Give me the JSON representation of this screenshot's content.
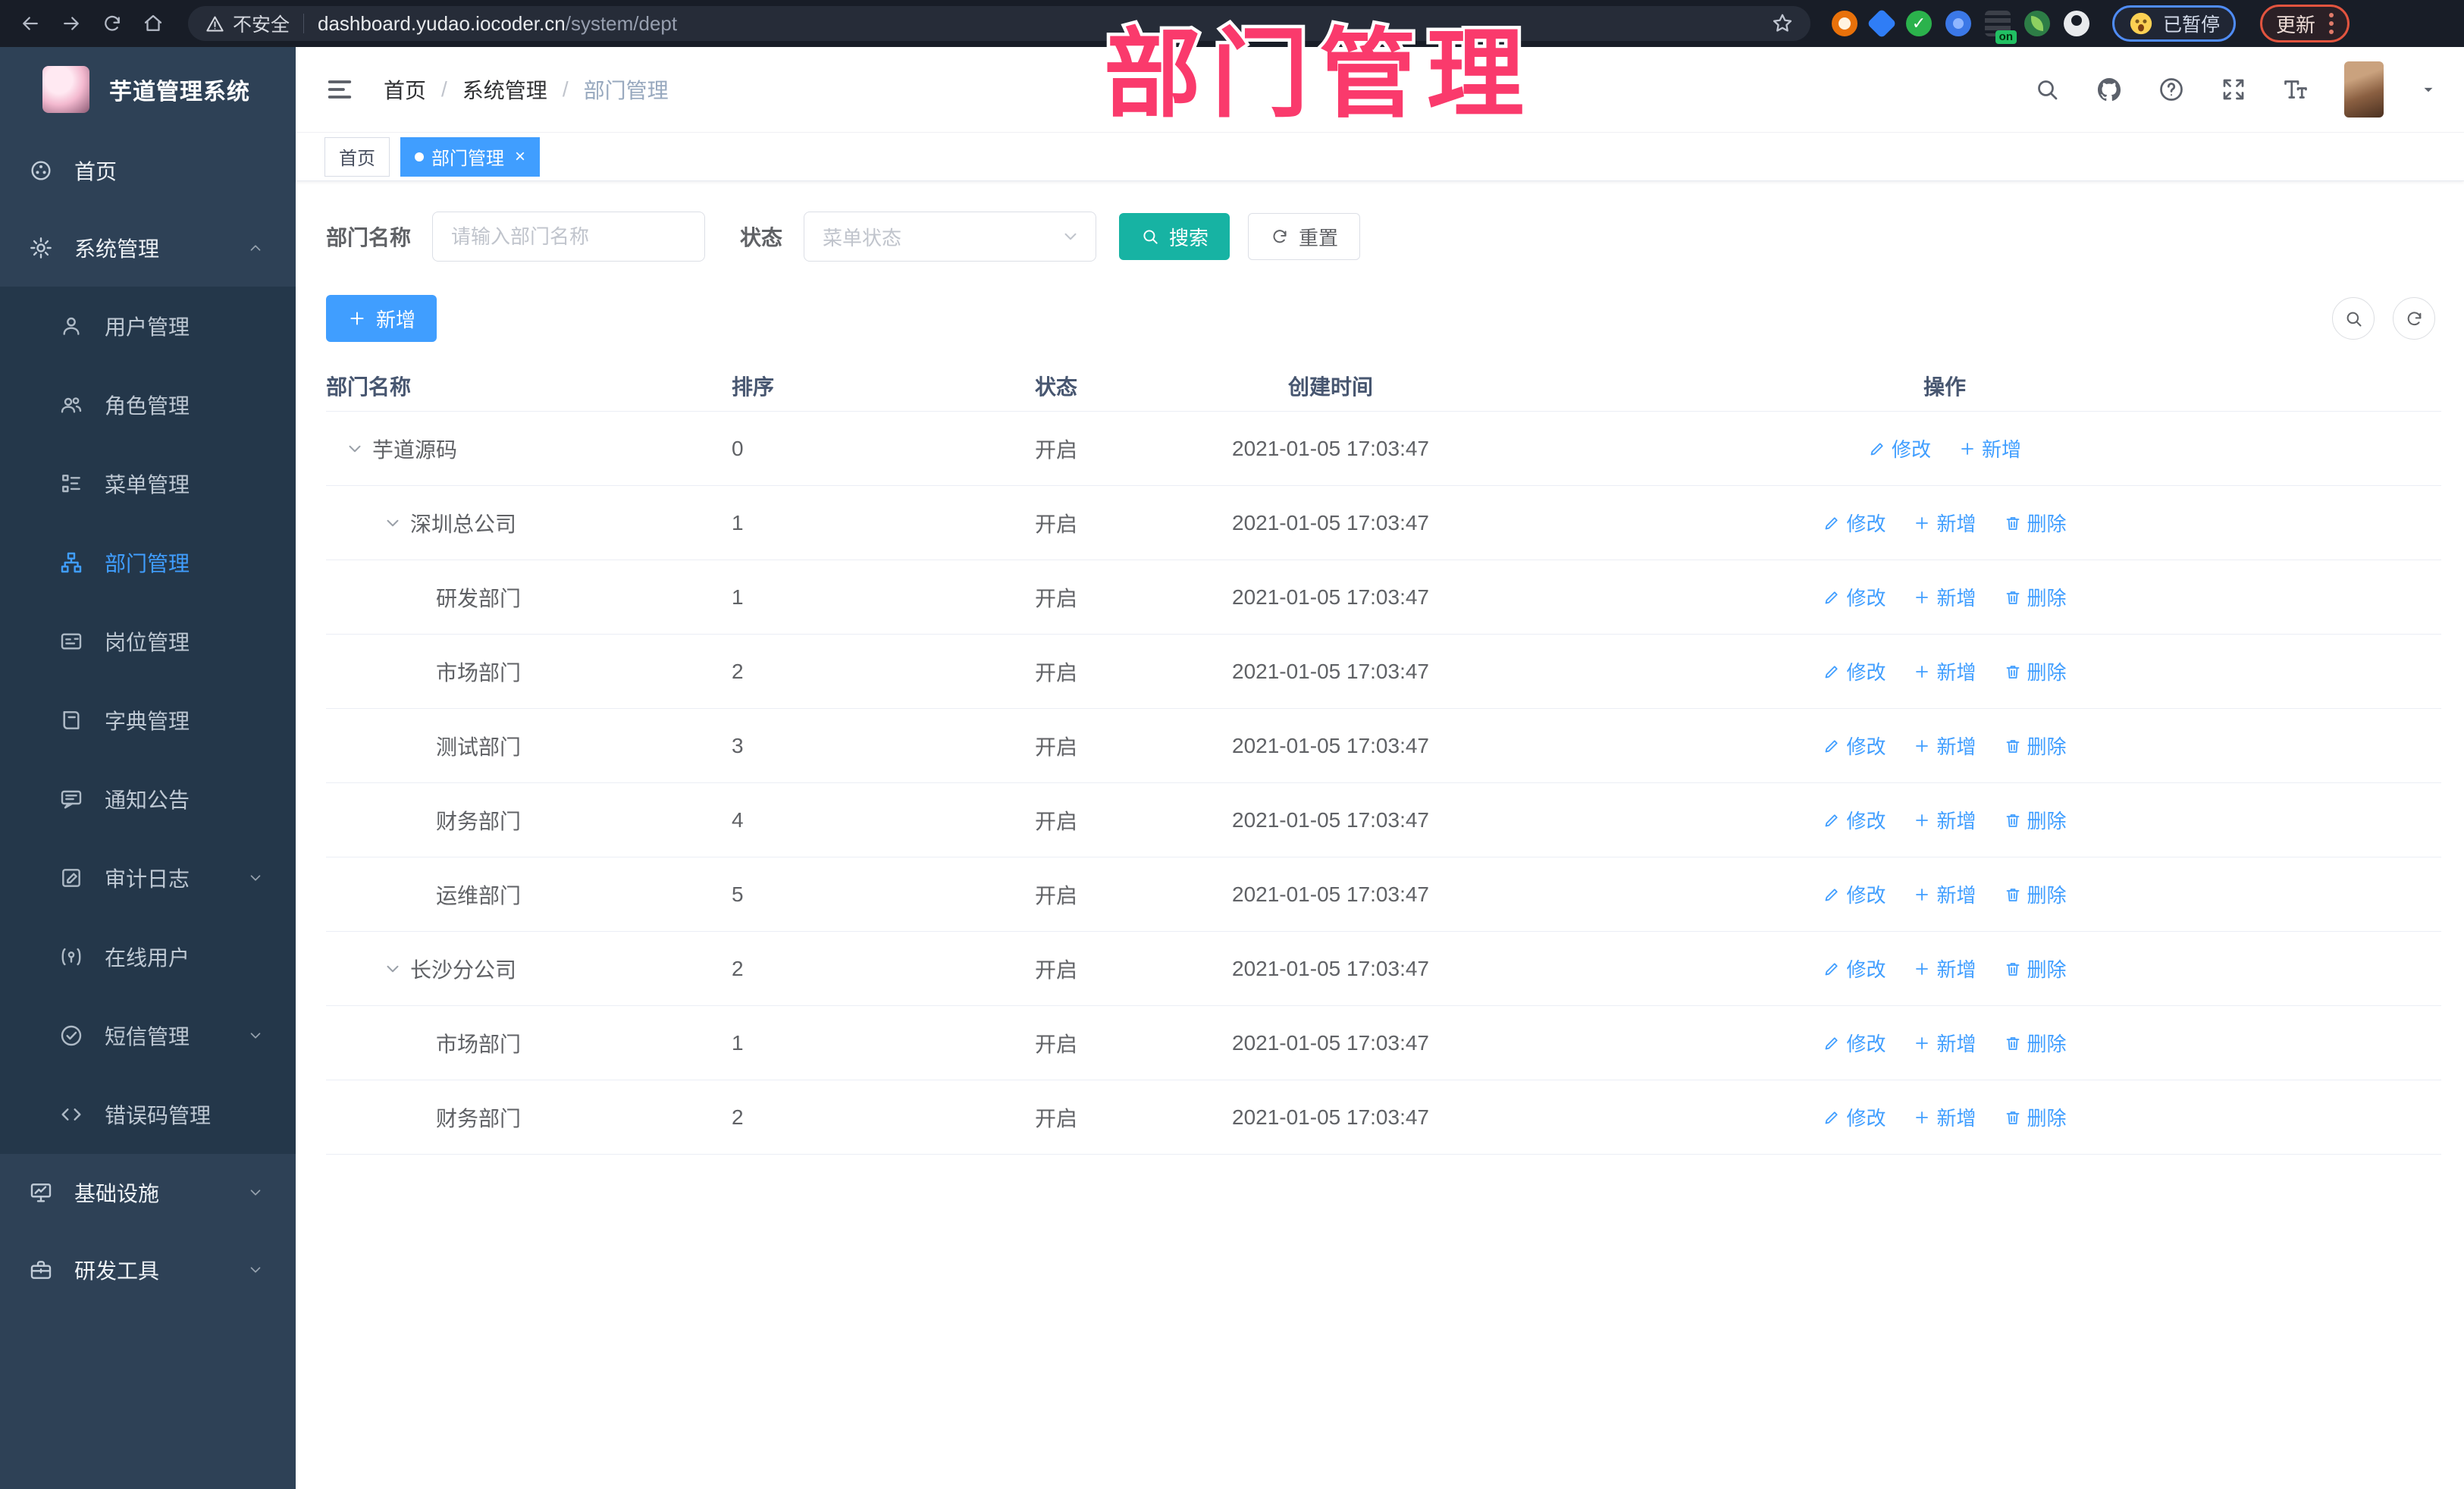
{
  "annotation": {
    "title": "部门管理"
  },
  "browser": {
    "security_label": "不安全",
    "url_host": "dashboard.yudao.iocoder.cn",
    "url_path": "/system/dept",
    "paused_badge": "已暂停",
    "update_button": "更新",
    "nav_icons": [
      "back-icon",
      "forward-icon",
      "reload-icon",
      "home-icon"
    ],
    "extensions": [
      "adblock-icon",
      "drop-extension-icon",
      "check-extension-icon",
      "puzzle-extension-icon",
      "switch-on-extension-icon",
      "leaf-extension-icon",
      "silhouette-extension-icon"
    ]
  },
  "sidebar": {
    "logo_title": "芋道管理系统",
    "items": [
      {
        "icon": "home-icon",
        "label": "首页",
        "type": "top"
      },
      {
        "icon": "gear-icon",
        "label": "系统管理",
        "type": "top",
        "chevron": "up"
      },
      {
        "icon": "user-icon",
        "label": "用户管理",
        "type": "sub"
      },
      {
        "icon": "users-icon",
        "label": "角色管理",
        "type": "sub"
      },
      {
        "icon": "menu-tree-icon",
        "label": "菜单管理",
        "type": "sub"
      },
      {
        "icon": "org-tree-icon",
        "label": "部门管理",
        "type": "sub",
        "active": true
      },
      {
        "icon": "id-card-icon",
        "label": "岗位管理",
        "type": "sub"
      },
      {
        "icon": "book-icon",
        "label": "字典管理",
        "type": "sub"
      },
      {
        "icon": "message-icon",
        "label": "通知公告",
        "type": "sub"
      },
      {
        "icon": "log-icon",
        "label": "审计日志",
        "type": "sub",
        "chevron": "down"
      },
      {
        "icon": "online-icon",
        "label": "在线用户",
        "type": "sub"
      },
      {
        "icon": "sms-icon",
        "label": "短信管理",
        "type": "sub",
        "chevron": "down"
      },
      {
        "icon": "code-icon",
        "label": "错误码管理",
        "type": "sub"
      },
      {
        "icon": "monitor-icon",
        "label": "基础设施",
        "type": "top",
        "chevron": "down"
      },
      {
        "icon": "briefcase-icon",
        "label": "研发工具",
        "type": "top",
        "chevron": "down"
      }
    ]
  },
  "header": {
    "breadcrumb": [
      "首页",
      "系统管理",
      "部门管理"
    ],
    "right_icons": [
      "search-icon",
      "github-icon",
      "question-icon",
      "fullscreen-icon",
      "text-size-icon",
      "avatar",
      "caret-down-icon"
    ]
  },
  "tags": [
    {
      "label": "首页",
      "active": false,
      "closable": false
    },
    {
      "label": "部门管理",
      "active": true,
      "closable": true
    }
  ],
  "filter": {
    "dept_label": "部门名称",
    "dept_placeholder": "请输入部门名称",
    "status_label": "状态",
    "status_placeholder": "菜单状态",
    "search_label": "搜索",
    "reset_label": "重置"
  },
  "toolbar": {
    "add_label": "新增"
  },
  "table": {
    "columns": [
      "部门名称",
      "排序",
      "状态",
      "创建时间",
      "操作"
    ],
    "action_defs": {
      "edit": {
        "label": "修改",
        "icon": "edit-icon"
      },
      "add": {
        "label": "新增",
        "icon": "plus-icon"
      },
      "delete": {
        "label": "删除",
        "icon": "trash-icon"
      }
    },
    "rows": [
      {
        "name": "芋道源码",
        "level": 0,
        "arrow": true,
        "sort": "0",
        "status": "开启",
        "created": "2021-01-05 17:03:47",
        "actions": [
          "edit",
          "add"
        ]
      },
      {
        "name": "深圳总公司",
        "level": 1,
        "arrow": true,
        "sort": "1",
        "status": "开启",
        "created": "2021-01-05 17:03:47",
        "actions": [
          "edit",
          "add",
          "delete"
        ]
      },
      {
        "name": "研发部门",
        "level": 2,
        "arrow": false,
        "sort": "1",
        "status": "开启",
        "created": "2021-01-05 17:03:47",
        "actions": [
          "edit",
          "add",
          "delete"
        ]
      },
      {
        "name": "市场部门",
        "level": 2,
        "arrow": false,
        "sort": "2",
        "status": "开启",
        "created": "2021-01-05 17:03:47",
        "actions": [
          "edit",
          "add",
          "delete"
        ]
      },
      {
        "name": "测试部门",
        "level": 2,
        "arrow": false,
        "sort": "3",
        "status": "开启",
        "created": "2021-01-05 17:03:47",
        "actions": [
          "edit",
          "add",
          "delete"
        ]
      },
      {
        "name": "财务部门",
        "level": 2,
        "arrow": false,
        "sort": "4",
        "status": "开启",
        "created": "2021-01-05 17:03:47",
        "actions": [
          "edit",
          "add",
          "delete"
        ]
      },
      {
        "name": "运维部门",
        "level": 2,
        "arrow": false,
        "sort": "5",
        "status": "开启",
        "created": "2021-01-05 17:03:47",
        "actions": [
          "edit",
          "add",
          "delete"
        ]
      },
      {
        "name": "长沙分公司",
        "level": 1,
        "arrow": true,
        "sort": "2",
        "status": "开启",
        "created": "2021-01-05 17:03:47",
        "actions": [
          "edit",
          "add",
          "delete"
        ]
      },
      {
        "name": "市场部门",
        "level": 2,
        "arrow": false,
        "sort": "1",
        "status": "开启",
        "created": "2021-01-05 17:03:47",
        "actions": [
          "edit",
          "add",
          "delete"
        ]
      },
      {
        "name": "财务部门",
        "level": 2,
        "arrow": false,
        "sort": "2",
        "status": "开启",
        "created": "2021-01-05 17:03:47",
        "actions": [
          "edit",
          "add",
          "delete"
        ]
      }
    ]
  },
  "colors": {
    "accent_blue": "#409eff",
    "search_teal": "#17b3a3",
    "annotation_pink": "#fa3a6c",
    "sidebar_bg": "#2e4156",
    "submenu_bg": "#24374a",
    "browser_bar_bg": "#181d27"
  }
}
